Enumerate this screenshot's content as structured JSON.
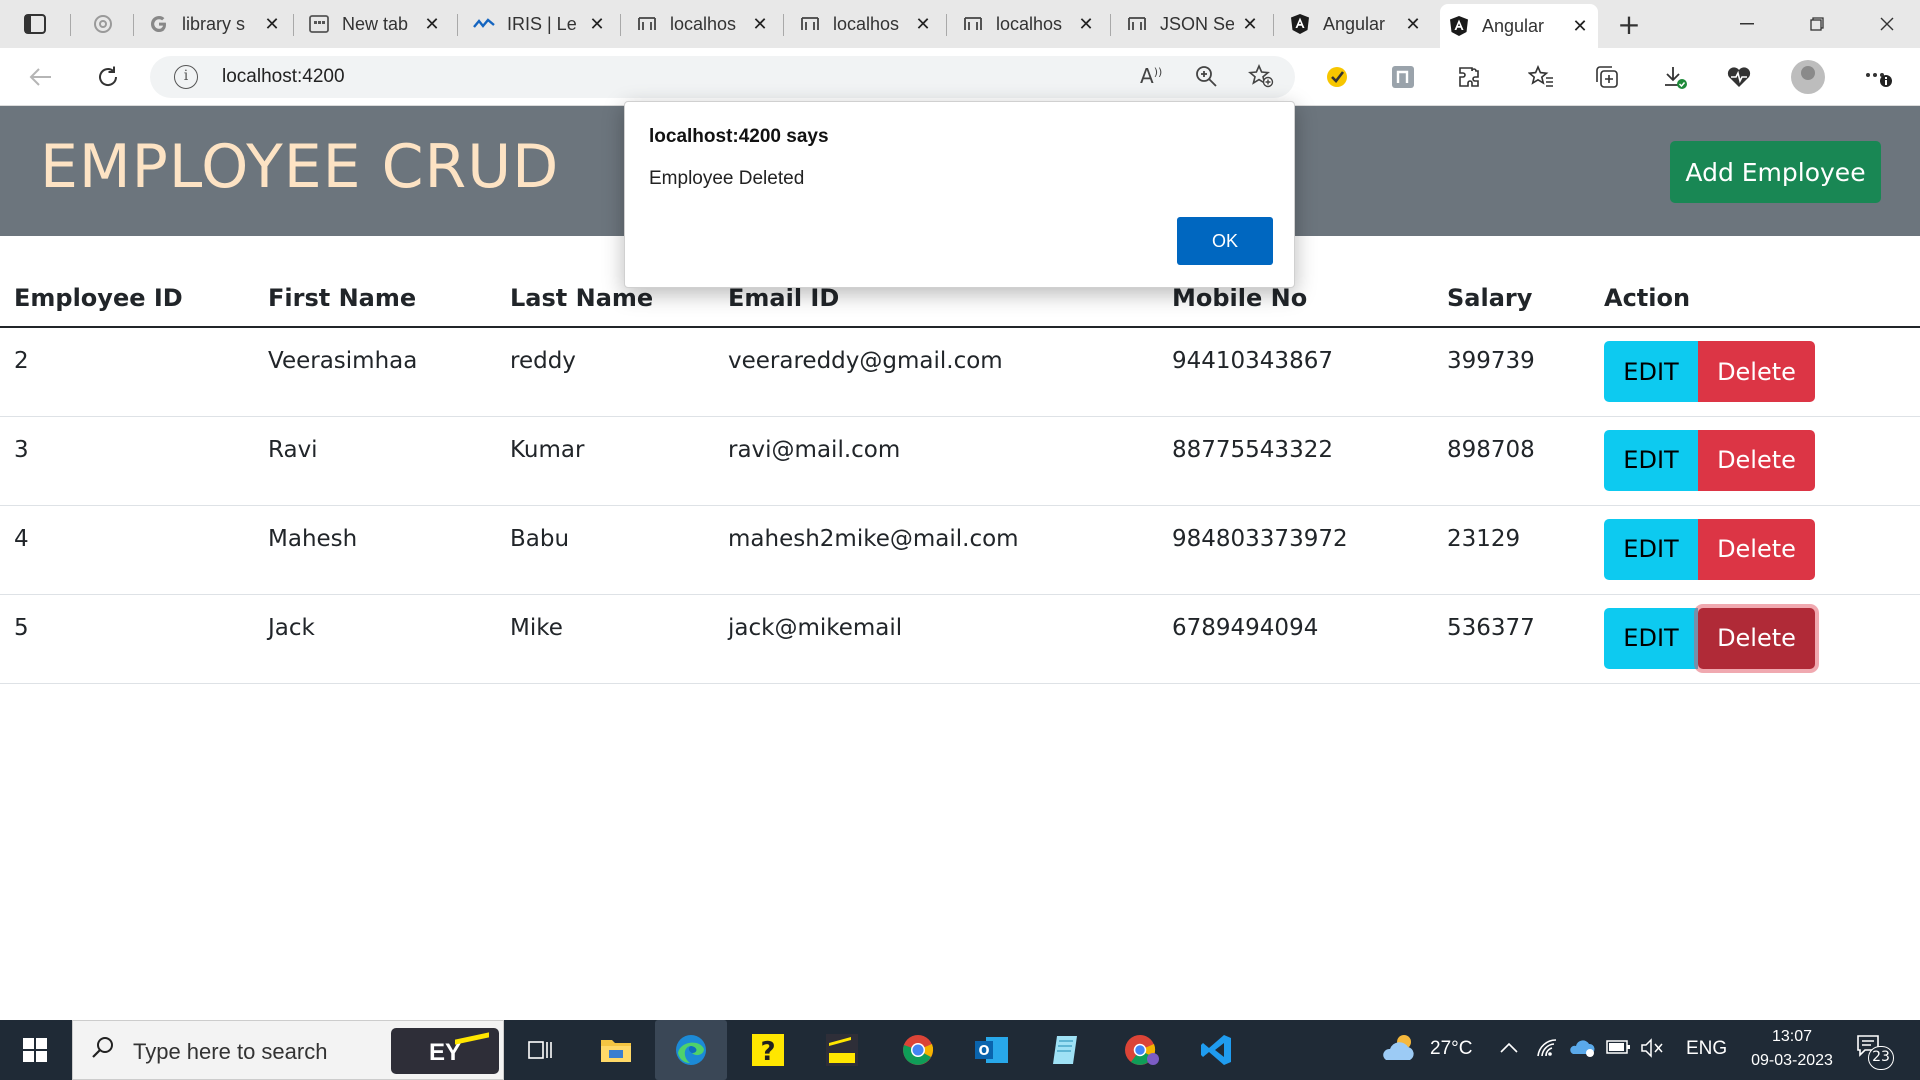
{
  "browser": {
    "tabs": [
      {
        "label": "",
        "icon": "chatgpt-icon"
      },
      {
        "label": "library s",
        "icon": "google-icon"
      },
      {
        "label": "New tab",
        "icon": "newtab-icon"
      },
      {
        "label": "IRIS | Le",
        "icon": "iris-icon"
      },
      {
        "label": "localhos",
        "icon": "localhost-icon"
      },
      {
        "label": "localhos",
        "icon": "localhost-icon"
      },
      {
        "label": "localhos",
        "icon": "localhost-icon"
      },
      {
        "label": "JSON Se",
        "icon": "localhost-icon"
      },
      {
        "label": "Angular",
        "icon": "angular-icon"
      },
      {
        "label": "Angular",
        "icon": "angular-icon"
      }
    ],
    "url": "localhost:4200"
  },
  "page": {
    "brand": "EMPLOYEE CRUD",
    "add_button": "Add Employee",
    "table": {
      "headers": [
        "Employee ID",
        "First Name",
        "Last Name",
        "Email ID",
        "Mobile No",
        "Salary",
        "Action"
      ],
      "rows": [
        {
          "id": "2",
          "first": "Veerasimhaa",
          "last": "reddy",
          "email": "veerareddy@gmail.com",
          "mobile": "94410343867",
          "salary": "399739"
        },
        {
          "id": "3",
          "first": "Ravi",
          "last": "Kumar",
          "email": "ravi@mail.com",
          "mobile": "88775543322",
          "salary": "898708"
        },
        {
          "id": "4",
          "first": "Mahesh",
          "last": "Babu",
          "email": "mahesh2mike@mail.com",
          "mobile": "984803373972",
          "salary": "23129"
        },
        {
          "id": "5",
          "first": "Jack",
          "last": "Mike",
          "email": "jack@mikemail",
          "mobile": "6789494094",
          "salary": "536377"
        }
      ],
      "edit_label": "EDIT",
      "delete_label": "Delete"
    }
  },
  "dialog": {
    "title": "localhost:4200 says",
    "message": "Employee Deleted",
    "ok_label": "OK"
  },
  "taskbar": {
    "search_placeholder": "Type here to search",
    "ey_badge": "EY",
    "temperature": "27°C",
    "language": "ENG",
    "time": "13:07",
    "date": "09-03-2023",
    "notification_count": "23"
  },
  "colors": {
    "navbar": "#6c757d",
    "brand_text": "#fde3c4",
    "add_button": "#198754",
    "edit_button": "#0dcaf0",
    "delete_button": "#dc3545",
    "dialog_ok": "#0067c0",
    "taskbar": "#1f2a36"
  }
}
